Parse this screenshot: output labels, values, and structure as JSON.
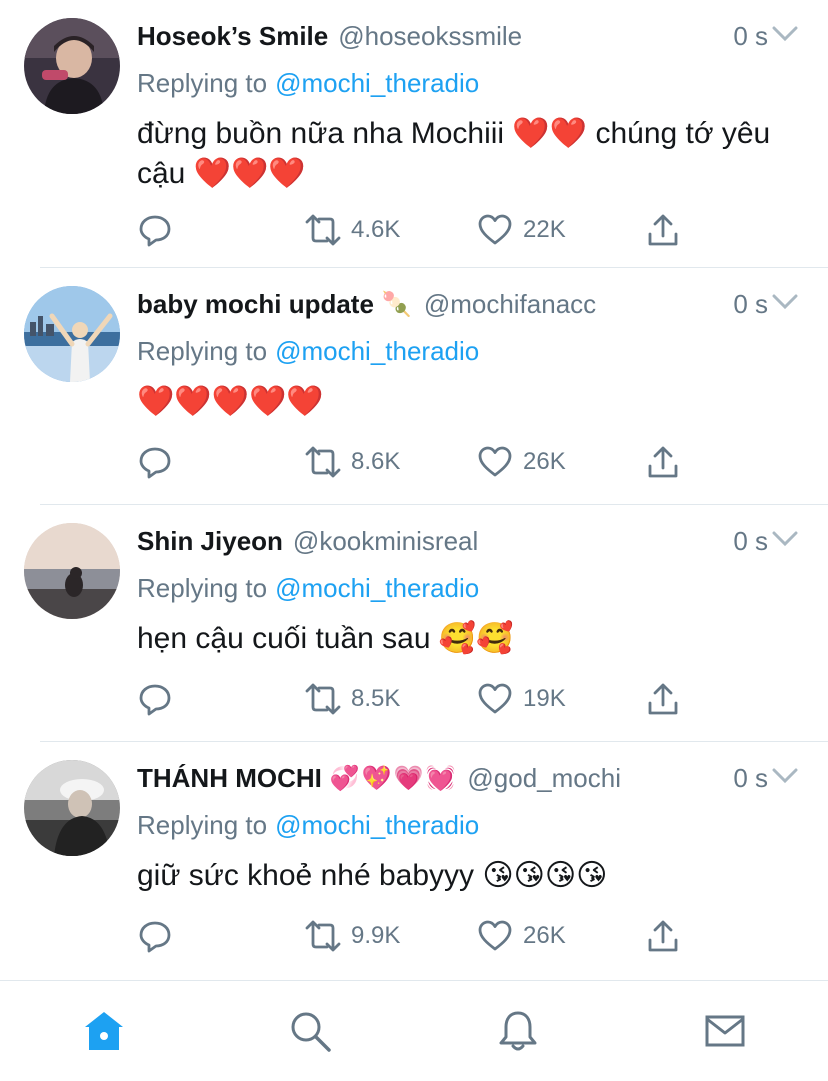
{
  "tweets": [
    {
      "name": "Hoseok’s Smile",
      "name_emoji": "",
      "handle": "@hoseokssmile",
      "time": "0 s",
      "replying_label": "Replying to",
      "replying_to": "@mochi_theradio",
      "text": "đừng buồn nữa nha Mochiii ❤️❤️ chúng tớ yêu cậu ❤️❤️❤️",
      "replies": "",
      "retweets": "4.6K",
      "likes": "22K"
    },
    {
      "name": "baby mochi update",
      "name_emoji": "🍡",
      "handle": "@mochifanacc",
      "time": "0 s",
      "replying_label": "Replying to",
      "replying_to": "@mochi_theradio",
      "text": "❤️❤️❤️❤️❤️",
      "replies": "",
      "retweets": "8.6K",
      "likes": "26K"
    },
    {
      "name": "Shin Jiyeon",
      "name_emoji": "",
      "handle": "@kookminisreal",
      "time": "0 s",
      "replying_label": "Replying to",
      "replying_to": "@mochi_theradio",
      "text": "hẹn cậu cuối tuần sau 🥰🥰",
      "replies": "",
      "retweets": "8.5K",
      "likes": "19K"
    },
    {
      "name": "THÁNH MOCHI",
      "name_emoji": "💞💖💗💓",
      "handle": "@god_mochi",
      "time": "0 s",
      "replying_label": "Replying to",
      "replying_to": "@mochi_theradio",
      "text": "giữ sức khoẻ nhé babyyy 😘😘😘😘",
      "replies": "",
      "retweets": "9.9K",
      "likes": "26K"
    }
  ],
  "icons": {
    "reply": "reply-icon",
    "retweet": "retweet-icon",
    "like": "heart-icon",
    "share": "share-icon",
    "more": "chevron-down-icon"
  },
  "tabbar": {
    "active": "home",
    "items": [
      "home-icon",
      "search-icon",
      "notifications-icon",
      "messages-icon"
    ]
  },
  "colors": {
    "accent": "#1da1f2",
    "muted": "#657786",
    "text": "#14171a",
    "divider": "#e1e8ed"
  }
}
